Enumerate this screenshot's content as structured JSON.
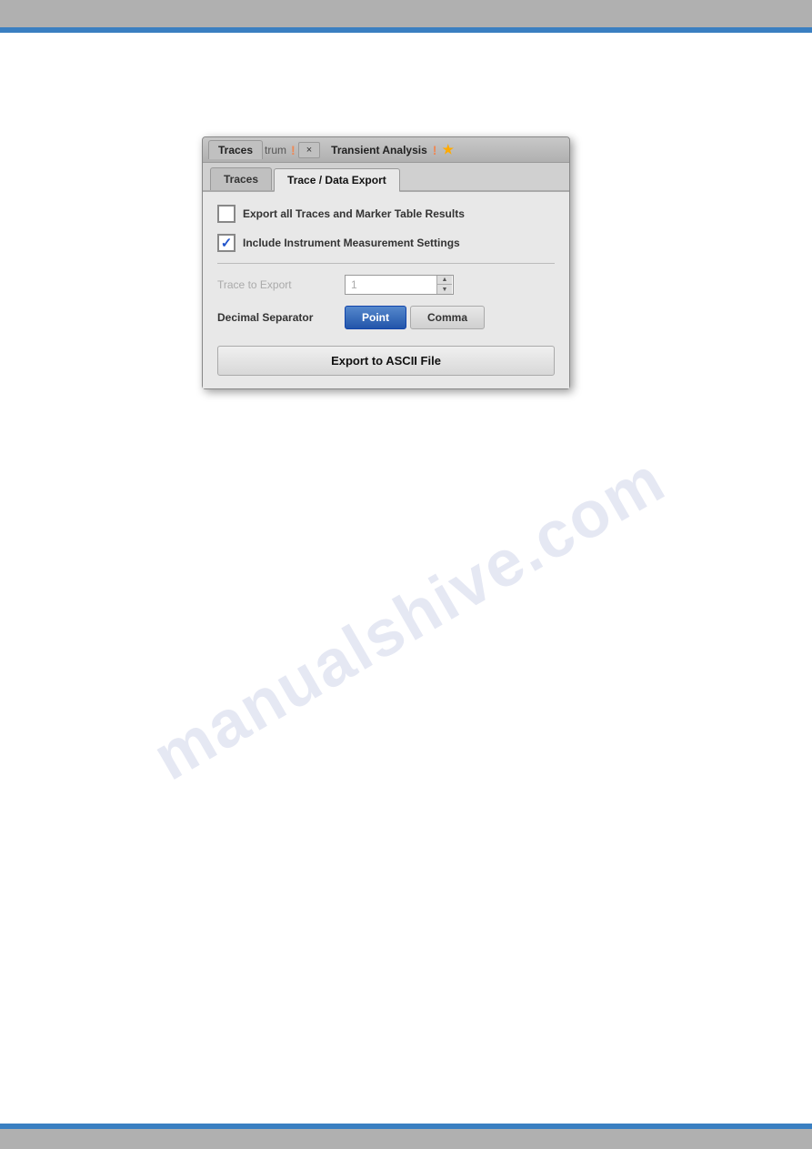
{
  "topBar": {
    "color": "#b0b0b0"
  },
  "bottomBar": {
    "color": "#b0b0b0"
  },
  "watermark": {
    "text": "manualshive.com"
  },
  "dialog": {
    "titleBar": {
      "tab1": "Traces",
      "separator1": "|",
      "tab2text": "trum",
      "exclaim1": "!",
      "closeLabel": "×",
      "title": "Transient Analysis",
      "exclaim2": "!",
      "star": "★"
    },
    "tabs": {
      "tab1": "Traces",
      "tab2": "Trace / Data Export"
    },
    "checkboxes": {
      "exportAllLabel": "Export all Traces and Marker Table Results",
      "exportAllChecked": false,
      "includeInstrumentLabel": "Include Instrument  Measurement Settings",
      "includeInstrumentChecked": true
    },
    "traceToExport": {
      "label": "Trace to Export",
      "value": "1"
    },
    "decimalSeparator": {
      "label": "Decimal Separator",
      "pointLabel": "Point",
      "commaLabel": "Comma",
      "selected": "point"
    },
    "exportButton": {
      "label": "Export to ASCII File"
    }
  }
}
